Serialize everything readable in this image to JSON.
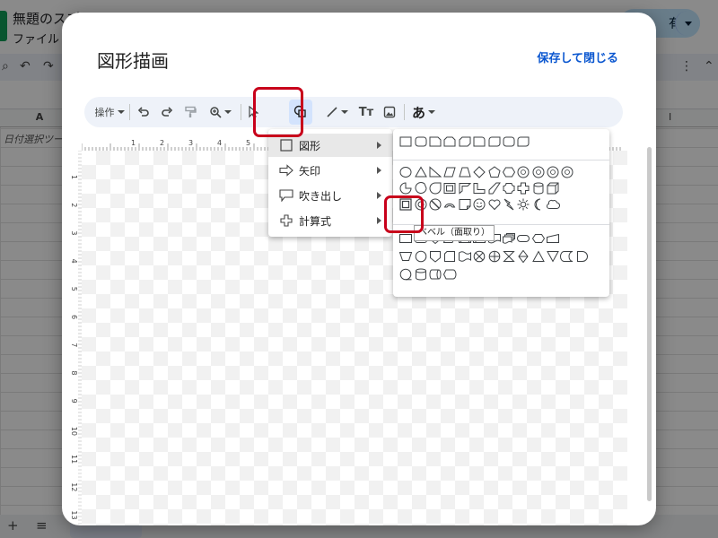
{
  "background": {
    "doc_title": "無題のスプ",
    "menu_file": "ファイル",
    "share_label": "有",
    "column_a": "A",
    "column_i": "I",
    "cell_text": "日付選択ツー"
  },
  "dialog": {
    "title": "図形描画",
    "save_close": "保存して閉じる"
  },
  "toolbar": {
    "actions_label": "操作",
    "text_icon_label": "Tт",
    "wordart_label": "あ"
  },
  "ruler": {
    "top": [
      "1",
      "2",
      "3",
      "4",
      "5",
      "6",
      "1"
    ],
    "left": [
      "1",
      "2",
      "3",
      "4",
      "5",
      "6",
      "7",
      "8",
      "9",
      "10",
      "11",
      "12",
      "13"
    ]
  },
  "menu": {
    "items": [
      {
        "label": "図形",
        "icon": "square-icon"
      },
      {
        "label": "矢印",
        "icon": "arrow-right-icon"
      },
      {
        "label": "吹き出し",
        "icon": "callout-icon"
      },
      {
        "label": "計算式",
        "icon": "plus-icon"
      }
    ]
  },
  "tooltip": "ベベル（面取り）",
  "colors": {
    "accent": "#0b57d0",
    "highlight": "#c8001b",
    "toolbar_bg": "#eef2f9",
    "selected_button": "#d3e3fd"
  }
}
